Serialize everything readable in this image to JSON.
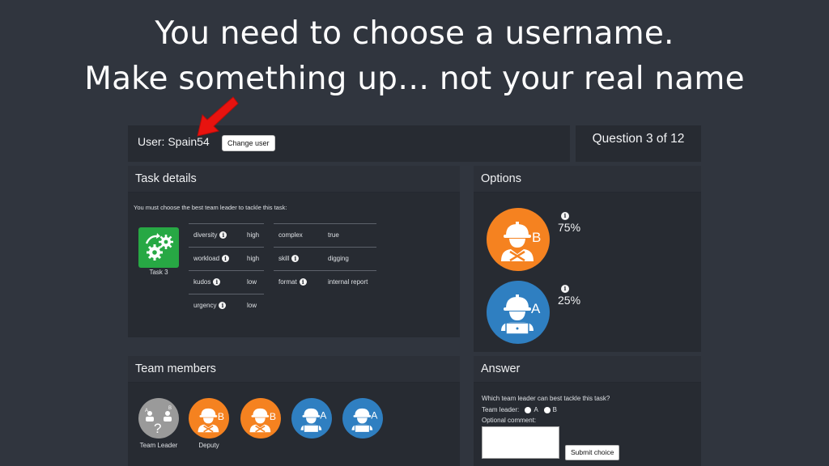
{
  "caption": {
    "line1": "You need to choose a username.",
    "line2": "Make something up… not your real name"
  },
  "header": {
    "user_label": "User: Spain54",
    "change_user": "Change user",
    "question": "Question 3 of 12"
  },
  "task": {
    "title": "Task details",
    "intro": "You must choose the best team leader to tackle this task:",
    "name": "Task 3",
    "tile_color": "#27a844",
    "attributes_left": [
      {
        "name": "diversity",
        "value": "high"
      },
      {
        "name": "workload",
        "value": "high"
      },
      {
        "name": "kudos",
        "value": "low"
      },
      {
        "name": "urgency",
        "value": "low"
      }
    ],
    "attributes_right": [
      {
        "name": "complex",
        "value": "true"
      },
      {
        "name": "skill",
        "value": "digging"
      },
      {
        "name": "format",
        "value": "internal report"
      }
    ]
  },
  "options": {
    "title": "Options",
    "items": [
      {
        "letter": "B",
        "percent": "75%",
        "color": "#f58220",
        "icon": "worker-tools-icon"
      },
      {
        "letter": "A",
        "percent": "25%",
        "color": "#2f7fc1",
        "icon": "worker-laptop-icon"
      }
    ]
  },
  "team": {
    "title": "Team members",
    "members": [
      {
        "role": "Team Leader",
        "color": "#9a9a9a",
        "icon": "unknown-leader-icon"
      },
      {
        "role": "Deputy",
        "letter": "B",
        "color": "#f58220",
        "icon": "worker-tools-icon"
      },
      {
        "role": "",
        "letter": "B",
        "color": "#f58220",
        "icon": "worker-tools-icon"
      },
      {
        "role": "",
        "letter": "A",
        "color": "#2f7fc1",
        "icon": "worker-laptop-icon"
      },
      {
        "role": "",
        "letter": "A",
        "color": "#2f7fc1",
        "icon": "worker-laptop-icon"
      }
    ]
  },
  "answer": {
    "title": "Answer",
    "question": "Which team leader can best tackle this task?",
    "leader_label": "Team leader:",
    "option_a": "A",
    "option_b": "B",
    "comment_label": "Optional comment:",
    "submit": "Submit choice"
  },
  "info_glyph": "i",
  "colors": {
    "background": "#30353e",
    "panel": "#272b32",
    "arrow": "#e8130f"
  }
}
